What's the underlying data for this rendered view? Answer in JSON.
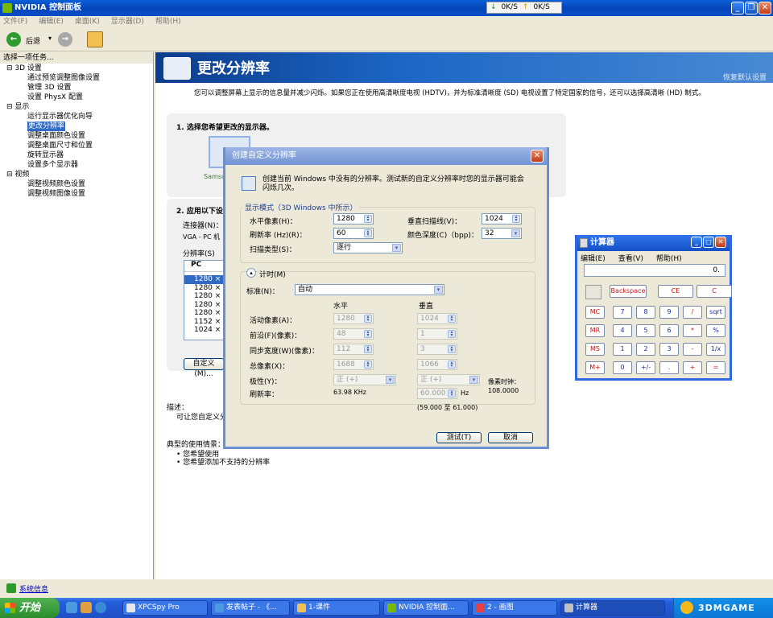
{
  "window": {
    "title": "NVIDIA 控制面板",
    "net_down": "0K/S",
    "net_up": "0K/S"
  },
  "menu": [
    "文件(F)",
    "编辑(E)",
    "桌面(K)",
    "显示器(D)",
    "帮助(H)"
  ],
  "toolbar": {
    "back_label": "后退"
  },
  "left": {
    "header": "选择一项任务...",
    "tree": [
      {
        "label": "3D 设置",
        "kind": "cat"
      },
      {
        "label": "通过预览调整图像设置",
        "kind": "item"
      },
      {
        "label": "管理 3D 设置",
        "kind": "item"
      },
      {
        "label": "设置 PhysX 配置",
        "kind": "item"
      },
      {
        "label": "显示",
        "kind": "cat"
      },
      {
        "label": "运行显示器优化向导",
        "kind": "item"
      },
      {
        "label": "更改分辨率",
        "kind": "sel"
      },
      {
        "label": "调整桌面颜色设置",
        "kind": "item"
      },
      {
        "label": "调整桌面尺寸和位置",
        "kind": "item"
      },
      {
        "label": "旋转显示器",
        "kind": "item"
      },
      {
        "label": "设置多个显示器",
        "kind": "item"
      },
      {
        "label": "视频",
        "kind": "cat"
      },
      {
        "label": "调整视频颜色设置",
        "kind": "item"
      },
      {
        "label": "调整视频图像设置",
        "kind": "item"
      }
    ],
    "system_info": "系统信息"
  },
  "main": {
    "title": "更改分辨率",
    "restore": "恢复默认设置",
    "description": "您可以调整屏幕上显示的信息量并减少闪烁。如果您正在使用高清晰度电视 (HDTV)，并为标准清晰度 (SD) 电视设置了特定国家的信号，还可以选择高清晰 (HD) 制式。",
    "step1": "1. 选择您希望更改的显示器。",
    "monitor_label": "Samsu",
    "step2": "2. 应用以下设",
    "connector_label": "连接器(N)：",
    "connector_value": "VGA - PC 机",
    "resolution_label": "分辨率(S)",
    "list_header": "PC",
    "resolutions": [
      "1280 ×",
      "1280 ×",
      "1280 ×",
      "1280 ×",
      "1280 ×",
      "1152 ×",
      "1024 ×"
    ],
    "custom_button": "自定义(M)...",
    "desc_label": "描述：",
    "desc_text": "可让您自定义分",
    "usage_label": "典型的使用情景：",
    "usage_items": [
      "• 您希望使用",
      "• 您希望添加不支持的分辨率"
    ]
  },
  "dialog": {
    "title": "创建自定义分辨率",
    "intro": "创建当前 Windows 中没有的分辨率。测试新的自定义分辨率时您的显示器可能会闪烁几次。",
    "mode_legend": "显示模式（3D Windows 中所示）",
    "h_pixels_label": "水平像素(H)：",
    "h_pixels": "1280",
    "v_lines_label": "垂直扫描线(V)：",
    "v_lines": "1024",
    "refresh_label": "刷新率 (Hz)(R)：",
    "refresh": "60",
    "depth_label": "颜色深度(C)（bpp)：",
    "depth": "32",
    "scan_label": "扫描类型(S)：",
    "scan": "逐行",
    "timing_label": "计时(M)",
    "standard_label": "标准(N)：",
    "standard": "自动",
    "col_h": "水平",
    "col_v": "垂直",
    "rows": [
      {
        "label": "活动像素(A)：",
        "h": "1280",
        "v": "1024"
      },
      {
        "label": "前沿(F)(像素)：",
        "h": "48",
        "v": "1"
      },
      {
        "label": "同步宽度(W)(像素)：",
        "h": "112",
        "v": "3"
      },
      {
        "label": "总像素(X)：",
        "h": "1688",
        "v": "1066"
      },
      {
        "label": "极性(Y)：",
        "h": "正 (+)",
        "v": "正 (+)"
      }
    ],
    "refresh_row_label": "刷新率：",
    "refresh_khz": "63.98 KHz",
    "refresh_hz": "60.000",
    "hz_unit": "Hz",
    "range": "(59.000 至 61.000)",
    "pixel_clock_label": "像素时钟：",
    "pixel_clock": "108.0000",
    "test_button": "测试(T)",
    "cancel_button": "取消"
  },
  "calc": {
    "title": "计算器",
    "menu": [
      "编辑(E)",
      "查看(V)",
      "帮助(H)"
    ],
    "display": "0.",
    "top_buttons": [
      "Backspace",
      "CE",
      "C"
    ],
    "rows": [
      [
        "MC",
        "7",
        "8",
        "9",
        "/",
        "sqrt"
      ],
      [
        "MR",
        "4",
        "5",
        "6",
        "*",
        "%"
      ],
      [
        "MS",
        "1",
        "2",
        "3",
        "-",
        "1/x"
      ],
      [
        "M+",
        "0",
        "+/-",
        ".",
        "+",
        "="
      ]
    ]
  },
  "taskbar": {
    "start": "开始",
    "items": [
      "XPCSpy Pro",
      "发表帖子 - 《...",
      "1-课件",
      "NVIDIA 控制面...",
      "2 - 画图",
      "计算器"
    ],
    "watermark": "3DMGAME"
  }
}
